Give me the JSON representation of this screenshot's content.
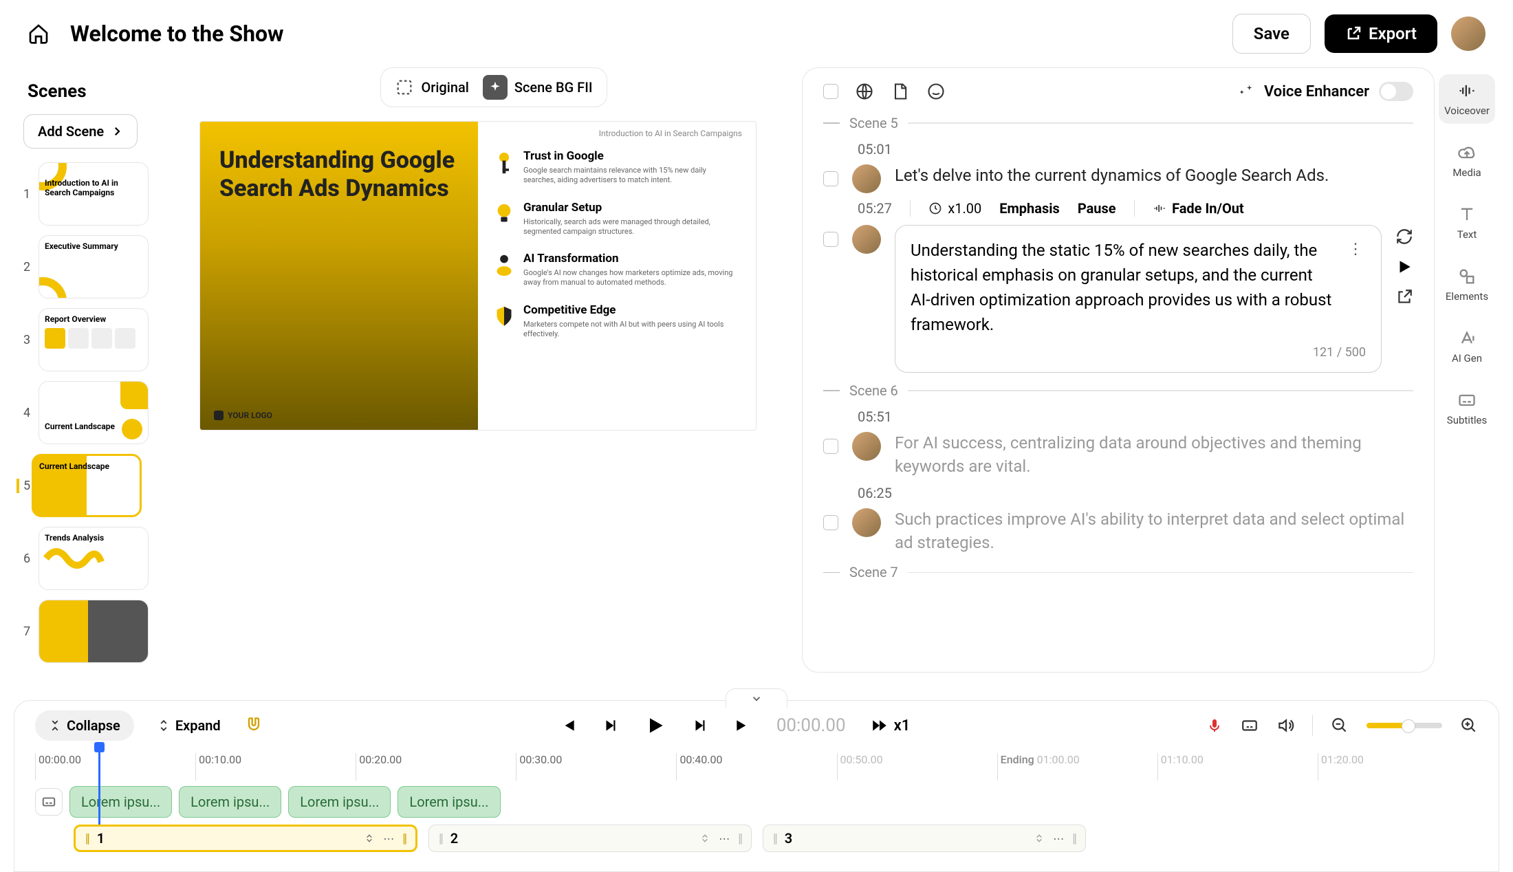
{
  "header": {
    "title": "Welcome to the Show",
    "save_label": "Save",
    "export_label": "Export"
  },
  "scenes_panel": {
    "title": "Scenes",
    "add_label": "Add Scene",
    "items": [
      {
        "num": "1",
        "title": "Introduction to AI in Search Campaigns"
      },
      {
        "num": "2",
        "title": "Executive Summary"
      },
      {
        "num": "3",
        "title": "Report Overview"
      },
      {
        "num": "4",
        "title": "Current Landscape"
      },
      {
        "num": "5",
        "title": "Current Landscape"
      },
      {
        "num": "6",
        "title": "Trends Analysis"
      },
      {
        "num": "7",
        "title": ""
      }
    ]
  },
  "canvas": {
    "original_label": "Original",
    "bgfill_label": "Scene BG FII",
    "slide": {
      "top_label": "Introduction to AI in Search Campaigns",
      "heading": "Understanding Google Search Ads Dynamics",
      "logo": "YOUR LOGO",
      "points": [
        {
          "title": "Trust in Google",
          "desc": "Google search maintains relevance with 15% new daily searches, aiding advertisers to match intent."
        },
        {
          "title": "Granular Setup",
          "desc": "Historically, search ads were managed through detailed, segmented campaign structures."
        },
        {
          "title": "AI Transformation",
          "desc": "Google's AI now changes how marketers optimize ads, moving away from manual to automated methods."
        },
        {
          "title": "Competitive Edge",
          "desc": "Marketers compete not with AI but with peers using AI tools effectively."
        }
      ]
    }
  },
  "voice": {
    "enhancer_label": "Voice Enhancer",
    "scene5_label": "Scene 5",
    "scene6_label": "Scene 6",
    "scene7_label": "Scene 7",
    "lines": {
      "t1": "05:01",
      "l1": "Let's delve into the current dynamics of Google Search Ads.",
      "t2": "05:27",
      "l2": "Understanding the static 15% of new searches daily, the historical emphasis on granular setups, and the current AI-driven optimization approach provides us with a robust framework.",
      "char_count": "121 / 500",
      "t3": "05:51",
      "l3": "For AI success, centralizing data around objectives and theming keywords are vital.",
      "t4": "06:25",
      "l4": "Such practices improve AI's ability to interpret data and select optimal ad strategies."
    },
    "toolbar": {
      "speed": "x1.00",
      "emphasis": "Emphasis",
      "pause": "Pause",
      "fade": "Fade In/Out"
    }
  },
  "rail": {
    "voiceover": "Voiceover",
    "media": "Media",
    "text": "Text",
    "elements": "Elements",
    "aigen": "AI Gen",
    "subtitles": "Subtitles"
  },
  "timeline": {
    "collapse": "Collapse",
    "expand": "Expand",
    "time": "00:00.00",
    "speed": "x1",
    "ticks": [
      "00:00.00",
      "00:10.00",
      "00:20.00",
      "00:30.00",
      "00:40.00",
      "00:50.00",
      "01:00.00",
      "01:10.00",
      "01:20.00"
    ],
    "ending_label": "Ending",
    "clips": [
      "Lorem ipsu...",
      "Lorem ipsu...",
      "Lorem ipsu...",
      "Lorem ipsu..."
    ],
    "scene_clips": [
      "1",
      "2",
      "3"
    ]
  }
}
